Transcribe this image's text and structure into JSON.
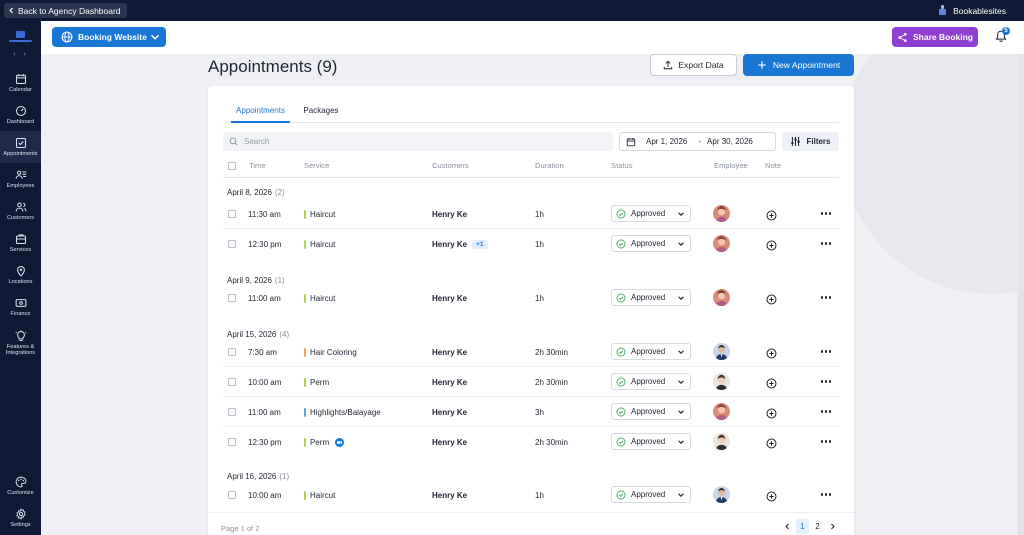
{
  "topbar": {
    "back_label": "Back to Agency Dashboard",
    "brand": "Bookablesites"
  },
  "sidebar": {
    "items": [
      {
        "label": "Calendar",
        "icon": "calendar-icon"
      },
      {
        "label": "Dashboard",
        "icon": "gauge-icon"
      },
      {
        "label": "Appointments",
        "icon": "checkbox-icon",
        "active": true
      },
      {
        "label": "Employees",
        "icon": "employees-icon"
      },
      {
        "label": "Customers",
        "icon": "users-icon"
      },
      {
        "label": "Services",
        "icon": "bag-icon"
      },
      {
        "label": "Locations",
        "icon": "pin-icon"
      },
      {
        "label": "Finance",
        "icon": "money-icon"
      },
      {
        "label": "Features & Integrations",
        "icon": "bulb-icon"
      }
    ],
    "bottom_items": [
      {
        "label": "Customize",
        "icon": "palette-icon"
      },
      {
        "label": "Settings",
        "icon": "gear-icon"
      }
    ]
  },
  "header": {
    "booking_site": "Booking Website",
    "share_label": "Share Booking",
    "notification_count": "5"
  },
  "page": {
    "title": "Appointments (9)",
    "export_label": "Export Data",
    "new_label": "New Appointment"
  },
  "tabs": [
    "Appointments",
    "Packages"
  ],
  "toolbar": {
    "search_placeholder": "Search",
    "date_start": "Apr 1, 2026",
    "date_sep": "-",
    "date_end": "Apr 30, 2026",
    "filters_label": "Filters"
  },
  "columns": {
    "time": "Time",
    "service": "Service",
    "customers": "Customers",
    "duration": "Duration",
    "status": "Status",
    "employee": "Employee",
    "note": "Note"
  },
  "groups": [
    {
      "date": "April 8, 2026",
      "count": "(2)",
      "rows": [
        {
          "time": "11:30 am",
          "service": "Haircut",
          "service_color": "#a8d45a",
          "customer": "Henry Ke",
          "extra": "",
          "duration": "1h",
          "status": "Approved",
          "avatar": "f"
        },
        {
          "time": "12:30 pm",
          "service": "Haircut",
          "service_color": "#a8d45a",
          "customer": "Henry Ke",
          "extra": "+1",
          "duration": "1h",
          "status": "Approved",
          "avatar": "f"
        }
      ]
    },
    {
      "date": "April 9, 2026",
      "count": "(1)",
      "rows": [
        {
          "time": "11:00 am",
          "service": "Haircut",
          "service_color": "#a8d45a",
          "customer": "Henry Ke",
          "extra": "",
          "duration": "1h",
          "status": "Approved",
          "avatar": "f"
        }
      ]
    },
    {
      "date": "April 15, 2026",
      "count": "(4)",
      "rows": [
        {
          "time": "7:30 am",
          "service": "Hair Coloring",
          "service_color": "#f2a35e",
          "customer": "Henry Ke",
          "extra": "",
          "duration": "2h 30min",
          "status": "Approved",
          "avatar": "m"
        },
        {
          "time": "10:00 am",
          "service": "Perm",
          "service_color": "#a8d45a",
          "customer": "Henry Ke",
          "extra": "",
          "duration": "2h 30min",
          "status": "Approved",
          "avatar": "g"
        },
        {
          "time": "11:00 am",
          "service": "Highlights/Balayage",
          "service_color": "#5aa9e6",
          "customer": "Henry Ke",
          "extra": "",
          "duration": "3h",
          "status": "Approved",
          "avatar": "f"
        },
        {
          "time": "12:30 pm",
          "service": "Perm",
          "service_color": "#a8d45a",
          "customer": "Henry Ke",
          "extra": "",
          "duration": "2h 30min",
          "status": "Approved",
          "avatar": "g",
          "video": true
        }
      ]
    },
    {
      "date": "April 16, 2026",
      "count": "(1)",
      "rows": [
        {
          "time": "10:00 am",
          "service": "Haircut",
          "service_color": "#a8d45a",
          "customer": "Henry Ke",
          "extra": "",
          "duration": "1h",
          "status": "Approved",
          "avatar": "m"
        }
      ]
    }
  ],
  "pagination": {
    "info": "Page 1 of 2",
    "pages": [
      "1",
      "2"
    ],
    "current": "1"
  },
  "colors": {
    "primary": "#1877d4",
    "share": "#8e3ed3",
    "sidebar": "#0e1a33",
    "approved": "#34a853"
  }
}
